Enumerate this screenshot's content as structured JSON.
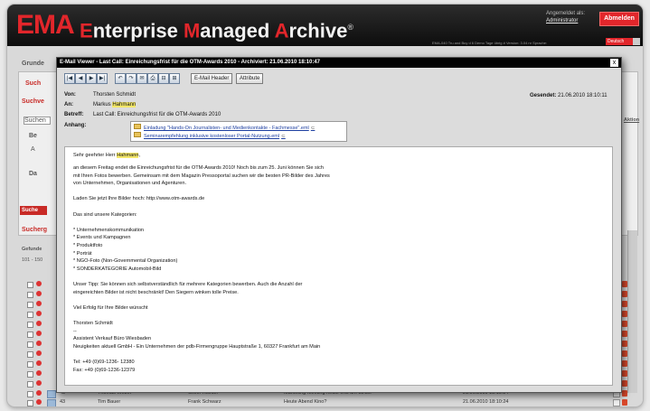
{
  "app": {
    "logo": "EMA",
    "title_parts": [
      {
        "t": "E",
        "c": "r"
      },
      {
        "t": "nterprise ",
        "c": "w"
      },
      {
        "t": "M",
        "c": "r"
      },
      {
        "t": "anaged ",
        "c": "w"
      },
      {
        "t": "A",
        "c": "r"
      },
      {
        "t": "rchive",
        "c": "w"
      }
    ],
    "trademark": "®",
    "user_label": "Angemeldet als:",
    "user_name": "Administrator",
    "logout": "Abmelden",
    "info_line": "EMA-040 Tru and Buy d 6 Demo Tage übrig # Version: 3.04 nr Sprache:",
    "language": "Deutsch",
    "accent": "#e2262b"
  },
  "background": {
    "tab_grunde": "Grunde",
    "tab_such": "Such",
    "suchvo": "Suchve",
    "suchen": "Suchen",
    "be": "Be",
    "a": "A",
    "da": "Da",
    "suche_btn": "Suche",
    "sucherg": "Sucherg",
    "gefunden": "Gefunde",
    "range": "101 - 150",
    "aktion": "Aktion",
    "rows": [
      {
        "id": "43",
        "from": "Thomas Weber",
        "to": "Oliver Richter",
        "subject": "Marketing-Meeting heute erst um 13:30!",
        "date": "21.06.2010 18:10:24"
      },
      {
        "id": "43",
        "from": "Tim Bauer",
        "to": "Frank Schwarz",
        "subject": "Heute Abend Kino?",
        "date": "21.06.2010 18:10:24"
      }
    ]
  },
  "viewer": {
    "title": "E-Mail Viewer - Last Call: Einreichungsfrist für die OTM-Awards 2010 - Archiviert: 21.06.2010 18:10:47",
    "close": "x",
    "nav_buttons": [
      "|◀",
      "◀",
      "▶",
      "▶|"
    ],
    "action_buttons": [
      "↶",
      "↷",
      "✉",
      "⎙",
      "⊟",
      "⊞"
    ],
    "header_btn": "E-Mail Header",
    "attribute_btn": "Attribute",
    "labels": {
      "from": "Von:",
      "to": "An:",
      "subject": "Betreff:",
      "attachments": "Anhang:",
      "sent": "Gesendet:"
    },
    "from": "Thorsten Schmidt",
    "to_pre": "Markus ",
    "to_name": "Hahmann",
    "subject": "Last Call: Einreichungsfrist für die OTM-Awards 2010",
    "sent": "21.06.2010 18:10:11",
    "attachments": [
      "Einladung \"Hands-On Journalisten- und Medienkontakte - Fachmesse\".eml",
      "Seminarempfehlung inklusive kostenloser Portal-Nutzung.eml"
    ],
    "body_greeting_pre": "Sehr geehrter Herr ",
    "body_greeting_name": "Hahmann",
    "body_greeting_post": ",",
    "body_lines": [
      "an diesem Freitag endet die Einreichungsfrist für die OTM-Awards 2010! Noch bis zum 25. Juni können Sie sich",
      "mit Ihren Fotos bewerben. Gemeinsam mit dem Magazin Pressoportal suchen wir die besten PR-Bilder des Jahres",
      "von Unternehmen, Organisationen und Agenturen.",
      "",
      "Laden Sie jetzt Ihre Bilder hoch: http://www.otm-awards.de",
      "",
      "Das sind unsere Kategorien:",
      "",
      "* Unternehmenskommunikation",
      "* Events und Kampagnen",
      "* Produktfoto",
      "* Porträt",
      "* NGO-Foto (Non-Governmental Organization)",
      "* SONDERKATEGORIE Automobil-Bild",
      "",
      "Unser Tipp: Sie können sich selbstverständlich für mehrere Kategorien bewerben. Auch die Anzahl der",
      "eingereichten Bilder ist nicht beschränkt! Den Siegern winken tolle Preise.",
      "",
      "Viel Erfolg für Ihre Bilder wünscht",
      "",
      "Thorsten Schmidt",
      "--",
      "Assistent Verkauf Büro Wiesbaden",
      "Neuigkeiten aktuell GmbH - Ein Unternehmen der pdb-Firmengruppe Hauptstraße 1, 60327 Frankfurt am Main",
      "",
      "Tel: +49 (0)69-1236- 12380",
      "Fax: +49 (0)69-1236-12379"
    ]
  }
}
